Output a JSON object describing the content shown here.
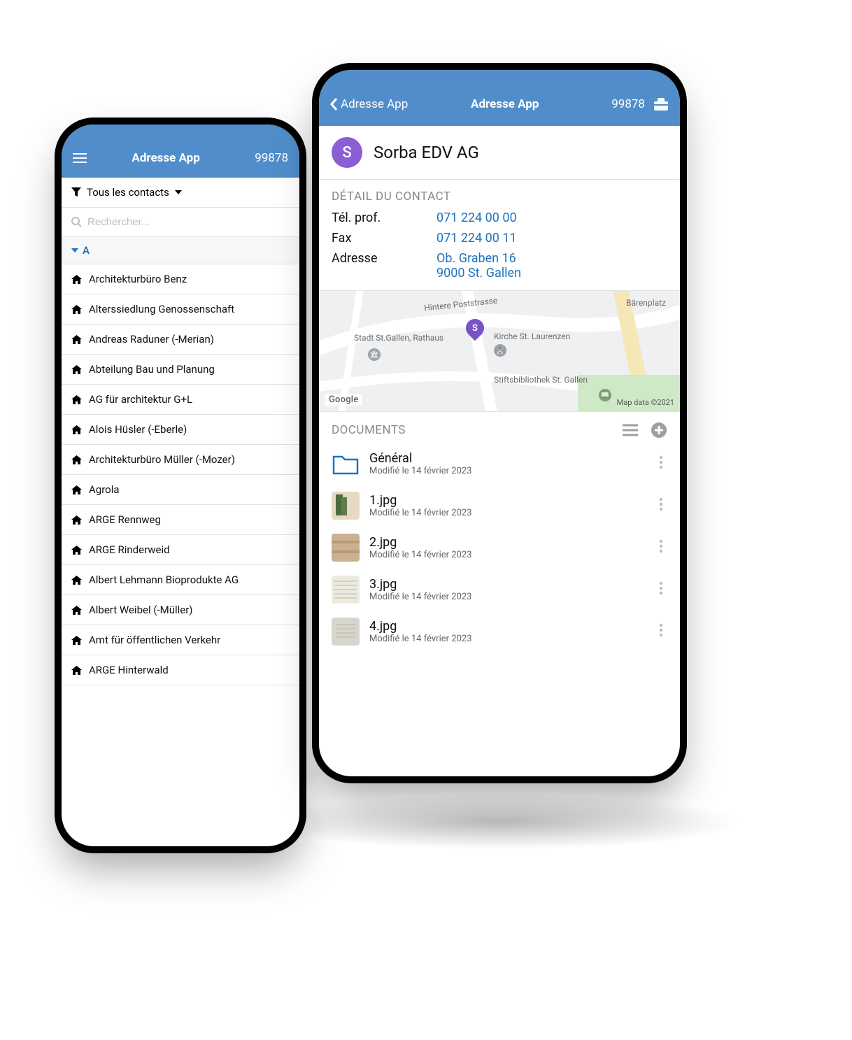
{
  "colors": {
    "brand": "#508dca",
    "link": "#1e73be",
    "avatar": "#8a5fd3"
  },
  "left": {
    "header": {
      "title": "Adresse App",
      "id": "99878"
    },
    "filter": {
      "label": "Tous les contacts"
    },
    "search": {
      "placeholder": "Rechercher..."
    },
    "sectionLetter": "A",
    "contacts": [
      {
        "name": "Architekturbüro Benz"
      },
      {
        "name": "Alterssiedlung Genossenschaft"
      },
      {
        "name": "Andreas Raduner (-Merian)"
      },
      {
        "name": "Abteilung Bau und Planung"
      },
      {
        "name": "AG für architektur G+L"
      },
      {
        "name": "Alois Hüsler (-Eberle)"
      },
      {
        "name": "Architekturbüro Müller (-Mozer)"
      },
      {
        "name": "Agrola"
      },
      {
        "name": "ARGE Rennweg"
      },
      {
        "name": "ARGE Rinderweid"
      },
      {
        "name": "Albert Lehmann Bioprodukte AG"
      },
      {
        "name": "Albert Weibel (-Müller)"
      },
      {
        "name": "Amt für öffentlichen Verkehr"
      },
      {
        "name": "ARGE Hinterwald"
      }
    ]
  },
  "right": {
    "header": {
      "back": "Adresse App",
      "title": "Adresse App",
      "id": "99878"
    },
    "contact": {
      "initial": "S",
      "name": "Sorba EDV AG",
      "sectionTitle": "DÉTAIL DU CONTACT",
      "telLabel": "Tél. prof.",
      "tel": "071 224 00 00",
      "faxLabel": "Fax",
      "fax": "071 224 00 11",
      "addrLabel": "Adresse",
      "addrLine1": "Ob. Graben 16",
      "addrLine2": "9000 St. Gallen"
    },
    "map": {
      "markerInitial": "S",
      "labels": {
        "poststrasse": "Hintere Poststrasse",
        "baerenplatz": "Bärenplatz",
        "rathaus": "Stadt St.Gallen, Rathaus",
        "kirche": "Kirche St. Laurenzen",
        "stift": "Stiftsbibliothek St. Gallen"
      },
      "googleBadge": "Google",
      "credit": "Map data ©2021"
    },
    "documents": {
      "title": "DOCUMENTS",
      "items": [
        {
          "kind": "folder",
          "name": "Général",
          "meta": "Modifié le 14 février 2023"
        },
        {
          "kind": "img1",
          "name": "1.jpg",
          "meta": "Modifié le 14 février 2023"
        },
        {
          "kind": "img2",
          "name": "2.jpg",
          "meta": "Modifié le 14 février 2023"
        },
        {
          "kind": "img3",
          "name": "3.jpg",
          "meta": "Modifié le 14 février 2023"
        },
        {
          "kind": "img4",
          "name": "4.jpg",
          "meta": "Modifié le 14 février 2023"
        }
      ]
    }
  }
}
